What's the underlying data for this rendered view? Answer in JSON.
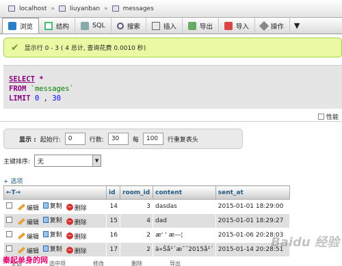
{
  "breadcrumb": {
    "server": "localhost",
    "database": "liuyanban",
    "table": "messages"
  },
  "tabs": [
    {
      "label": "浏览",
      "icon": "browse-icon"
    },
    {
      "label": "结构",
      "icon": "structure-icon"
    },
    {
      "label": "SQL",
      "icon": "sql-icon"
    },
    {
      "label": "搜索",
      "icon": "search-icon"
    },
    {
      "label": "插入",
      "icon": "insert-icon"
    },
    {
      "label": "导出",
      "icon": "export-icon"
    },
    {
      "label": "导入",
      "icon": "import-icon"
    },
    {
      "label": "操作",
      "icon": "operations-icon"
    }
  ],
  "tabs_more": "▼",
  "success": {
    "message": "显示行 0 - 3 ( 4 总计, 查询花费 0.0010 秒)"
  },
  "sql": {
    "select": "SELECT",
    "star": "*",
    "from": "FROM",
    "table": "`messages`",
    "limit": "LIMIT",
    "offset": "0",
    "sep": ",",
    "count": "30"
  },
  "profiling": {
    "label": "性能"
  },
  "nav": {
    "show_label": "显示 :",
    "start_label": "起始行:",
    "start_value": "0",
    "rows_label": "行数:",
    "rows_value": "30",
    "every_label": "每",
    "every_value": "100",
    "repeat_label": "行重复表头"
  },
  "sort": {
    "label": "主键排序:",
    "value": "无",
    "arrow": "▼"
  },
  "options_link": "+ 选项",
  "table": {
    "nav_arrows": "←T→",
    "columns": [
      "id",
      "room_id",
      "content",
      "sent_at"
    ],
    "actions": {
      "edit": "编辑",
      "copy": "复制",
      "delete": "删除"
    },
    "rows": [
      {
        "id": "14",
        "room_id": "3",
        "content": "dasdas",
        "sent_at": "2015-01-01 18:29:00"
      },
      {
        "id": "15",
        "room_id": "4",
        "content": "dad",
        "sent_at": "2015-01-01 18:29:27"
      },
      {
        "id": "16",
        "room_id": "2",
        "content": "æ' ' æ—¦",
        "sent_at": "2015-01-06 20:28:03"
      },
      {
        "id": "17",
        "room_id": "2",
        "content": "ä»Šå¹´æ˜¯2015å¹´",
        "sent_at": "2015-01-14 20:28:51"
      }
    ]
  },
  "watermark": "秦起单身的网",
  "logo": "Baidu 经验",
  "bottom_ops": [
    "全选",
    "选中项",
    "修改",
    "删除",
    "导出"
  ]
}
